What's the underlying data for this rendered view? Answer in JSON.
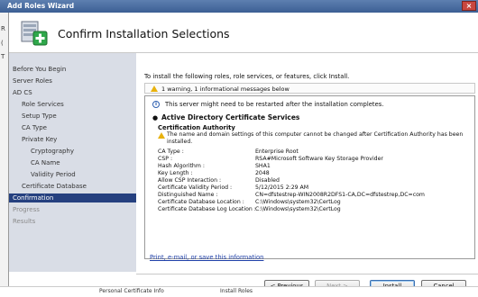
{
  "window": {
    "title": "Add Roles Wizard",
    "close_glyph": "×"
  },
  "left_strip": {
    "chars": [
      "R",
      "(",
      "T"
    ]
  },
  "header": {
    "title": "Confirm Installation Selections",
    "icon": "server-add-icon"
  },
  "nav": {
    "items": [
      {
        "label": "Before You Begin",
        "state": "normal"
      },
      {
        "label": "Server Roles",
        "state": "normal"
      },
      {
        "label": "AD CS",
        "state": "normal"
      },
      {
        "label": "Role Services",
        "state": "normal"
      },
      {
        "label": "Setup Type",
        "state": "normal"
      },
      {
        "label": "CA Type",
        "state": "normal"
      },
      {
        "label": "Private Key",
        "state": "normal"
      },
      {
        "label": "Cryptography",
        "state": "normal"
      },
      {
        "label": "CA Name",
        "state": "normal"
      },
      {
        "label": "Validity Period",
        "state": "normal"
      },
      {
        "label": "Certificate Database",
        "state": "normal"
      },
      {
        "label": "Confirmation",
        "state": "selected"
      },
      {
        "label": "Progress",
        "state": "disabled"
      },
      {
        "label": "Results",
        "state": "disabled"
      }
    ]
  },
  "content": {
    "instruction": "To install the following roles, role services, or features, click Install.",
    "warning_bar": "1 warning, 1 informational messages below",
    "info_message": "This server might need to be restarted after the installation completes.",
    "section_title": "Active Directory Certificate Services",
    "subsection_title": "Certification Authority",
    "note": "The name and domain settings of this computer cannot be changed after Certification Authority has been installed.",
    "details": [
      {
        "key": "CA Type :",
        "value": "Enterprise Root"
      },
      {
        "key": "CSP :",
        "value": "RSA#Microsoft Software Key Storage Provider"
      },
      {
        "key": "Hash Algorithm :",
        "value": "SHA1"
      },
      {
        "key": "Key Length :",
        "value": "2048"
      },
      {
        "key": "Allow CSP Interaction :",
        "value": "Disabled"
      },
      {
        "key": "Certificate Validity Period :",
        "value": "5/12/2015 2:29 AM"
      },
      {
        "key": "Distinguished Name :",
        "value": "CN=dfstestrep-WIN2008R2DFS1-CA,DC=dfstestrep,DC=com"
      },
      {
        "key": "Certificate Database Location :",
        "value": "C:\\Windows\\system32\\CertLog"
      },
      {
        "key": "Certificate Database Log Location :",
        "value": "C:\\Windows\\system32\\CertLog"
      }
    ],
    "link": "Print, e-mail, or save this information"
  },
  "footer": {
    "previous": "< Previous",
    "next": "Next >",
    "install": "Install",
    "cancel": "Cancel"
  },
  "taskbar": {
    "items": [
      "Personal Certificate Info",
      "Install Roles"
    ]
  }
}
